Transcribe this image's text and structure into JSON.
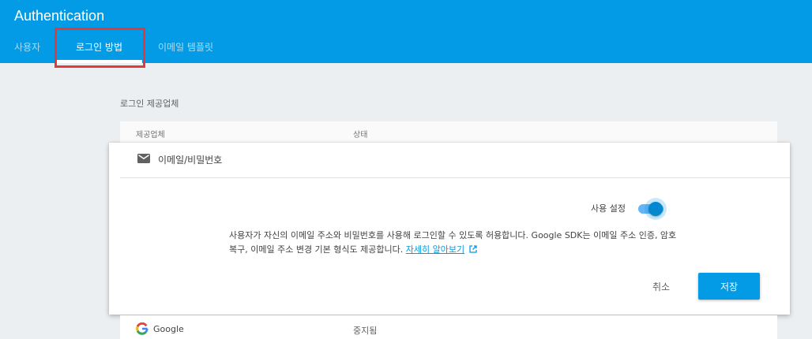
{
  "header": {
    "title": "Authentication",
    "tabs": [
      {
        "label": "사용자"
      },
      {
        "label": "로그인 방법"
      },
      {
        "label": "이메일 템플릿"
      }
    ]
  },
  "providers_section": {
    "title": "로그인 제공업체",
    "columns": {
      "provider": "제공업체",
      "status": "상태"
    }
  },
  "email_provider": {
    "name": "이메일/비밀번호",
    "icon": "mail-icon",
    "toggle_label": "사용 설정",
    "enabled": true,
    "description": "사용자가 자신의 이메일 주소와 비밀번호를 사용해 로그인할 수 있도록 허용합니다. Google SDK는 이메일 주소 인증, 암호 복구, 이메일 주소 변경 기본 형식도 제공합니다.",
    "learn_more": "자세히 알아보기",
    "cancel_label": "취소",
    "save_label": "저장"
  },
  "google_provider": {
    "name": "Google",
    "status": "중지됨",
    "icon": "google-icon"
  },
  "colors": {
    "primary": "#039be5",
    "highlight": "#e53935"
  }
}
